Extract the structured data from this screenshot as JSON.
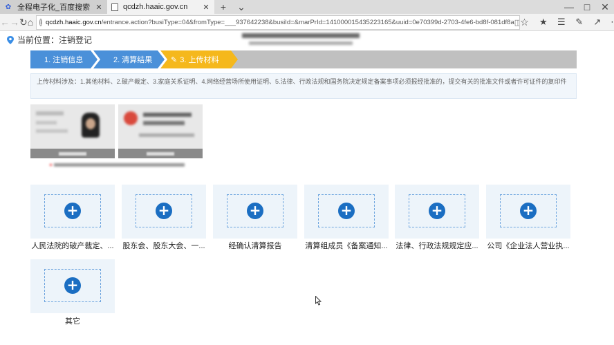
{
  "browser": {
    "tabs": [
      {
        "title": "全程电子化_百度搜索",
        "icon": "baidu-paw-icon",
        "active": false
      },
      {
        "title": "qcdzh.haaic.gov.cn",
        "icon": "page-icon",
        "active": true
      }
    ],
    "url_host": "qcdzh.haaic.gov.cn",
    "url_path": "/entrance.action?busiType=04&fromType=___937642238&busiId=&marPrId=141000015435223165&uuid=0e70399d-2703-4fe6-bd8f-081df8a"
  },
  "location": {
    "label": "当前位置：注销登记"
  },
  "steps": [
    {
      "label": "1. 注销信息",
      "state": "done",
      "color": "#4a90d9"
    },
    {
      "label": "2. 清算结果",
      "state": "done",
      "color": "#4a90d9"
    },
    {
      "label": "3. 上传材料",
      "state": "current",
      "color": "#f5b81c"
    }
  ],
  "info": {
    "text": "上传材料涉及：1.其他材料、2.破产裁定、3.家庭关系证明、4.网络经营场所使用证明、5.法律、行政法规和国务院决定规定备案事项必须报经批准的，提交有关的批准文件或者许可证件的复印件"
  },
  "upload_items": [
    {
      "label": "人民法院的破产裁定、..."
    },
    {
      "label": "股东会、股东大会、一..."
    },
    {
      "label": "经确认清算报告"
    },
    {
      "label": "清算组成员《备案通知..."
    },
    {
      "label": "法律、行政法规规定应..."
    },
    {
      "label": "公司《企业法人营业执..."
    },
    {
      "label": "其它"
    }
  ],
  "colors": {
    "accent": "#1b6ec2",
    "step_done": "#4a90d9",
    "step_current": "#f5b81c",
    "step_bar": "#c0c0c0"
  }
}
